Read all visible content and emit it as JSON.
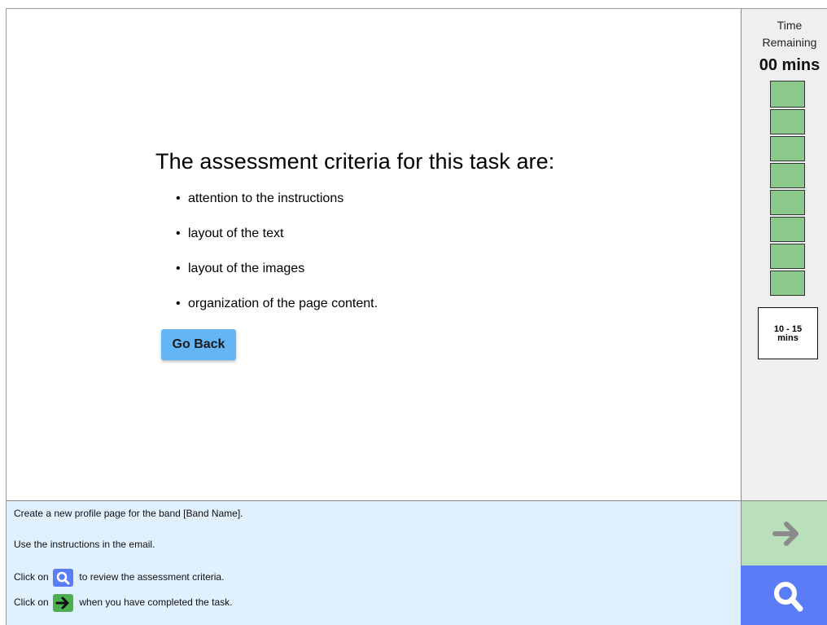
{
  "criteria": {
    "title": "The assessment criteria for this task are:",
    "items": [
      "attention to the instructions",
      "layout of the text",
      "layout of the images",
      "organization of the page content."
    ],
    "go_back_label": "Go Back"
  },
  "timer": {
    "label_line1": "Time",
    "label_line2": "Remaining",
    "value": "00 mins",
    "blocks_remaining": 8,
    "range_line1": "10 - 15",
    "range_line2": "mins"
  },
  "instructions": {
    "line1": "Create a new profile page for the band [Band Name].",
    "line2": "Use the instructions in the email.",
    "line3_pre": "Click on",
    "line3_post": "to review the assessment criteria.",
    "line4_pre": "Click on",
    "line4_post": "when you have completed the task."
  },
  "icons": {
    "next": "arrow-right-icon",
    "review": "search-icon"
  },
  "colors": {
    "go_back": "#64b5f6",
    "timer_block": "#8bc98b",
    "instructions_bg": "#e1f0fd",
    "next_bg": "#b9dfbb",
    "review_bg": "#5b7cf7"
  }
}
